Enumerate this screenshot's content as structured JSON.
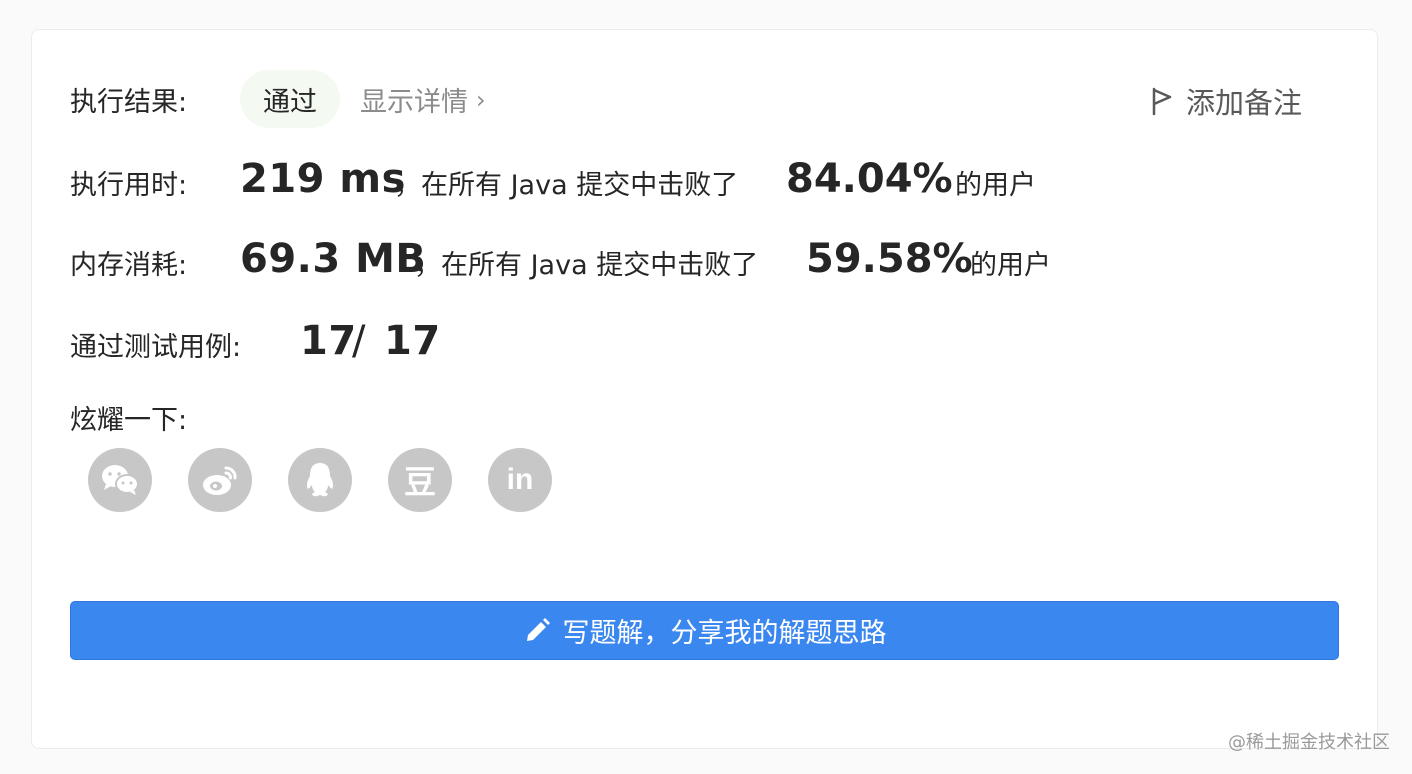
{
  "result": {
    "label": "执行结果:",
    "status": "通过",
    "details_link": "显示详情",
    "details_chevron": "›",
    "add_note": "添加备注"
  },
  "runtime": {
    "label": "执行用时:",
    "value": "219 ms",
    "text_before": "，在所有 Java 提交中击败了",
    "percent": "84.04%",
    "text_after": "的用户"
  },
  "memory": {
    "label": "内存消耗:",
    "value": "69.3 MB",
    "text_before": "，在所有 Java 提交中击败了",
    "percent": "59.58%",
    "text_after": "的用户"
  },
  "tests": {
    "label": "通过测试用例:",
    "passed": "17",
    "separator": "/",
    "total": "17"
  },
  "share": {
    "label": "炫耀一下:",
    "icons": [
      "wechat-icon",
      "weibo-icon",
      "qq-icon",
      "douban-icon",
      "linkedin-icon"
    ],
    "douban_glyph": "豆",
    "linkedin_glyph": "in"
  },
  "cta": {
    "label": "写题解，分享我的解题思路"
  },
  "watermark": "@稀土掘金技术社区",
  "colors": {
    "accent": "#3b87f0",
    "badge_bg": "#f4f9f2",
    "share_icon_bg": "#c7c7c7",
    "muted": "#8c8c8c"
  }
}
